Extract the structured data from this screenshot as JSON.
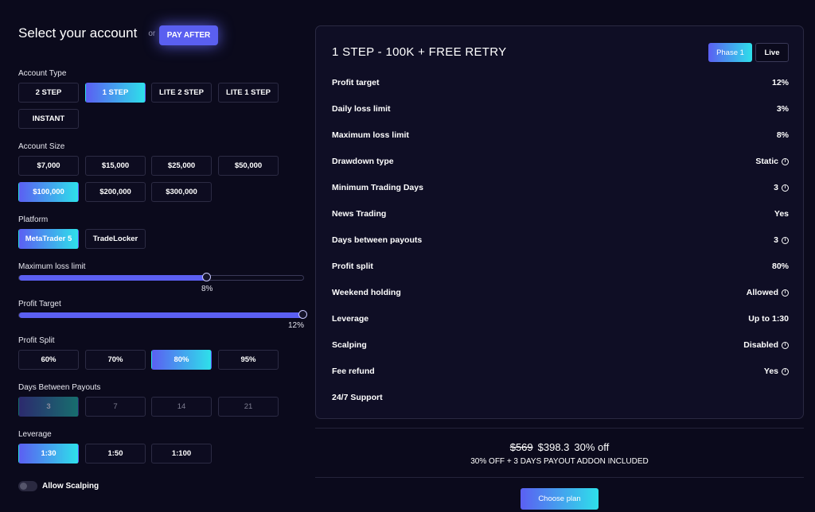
{
  "header": {
    "title": "Select your account",
    "or_text": "or",
    "pay_after_label": "PAY AFTER"
  },
  "account_type": {
    "label": "Account Type",
    "options": [
      "2 STEP",
      "1 STEP",
      "LITE 2 STEP",
      "LITE 1 STEP",
      "INSTANT"
    ],
    "selected": "1 STEP"
  },
  "account_size": {
    "label": "Account Size",
    "options": [
      "$7,000",
      "$15,000",
      "$25,000",
      "$50,000",
      "$100,000",
      "$200,000",
      "$300,000"
    ],
    "selected": "$100,000"
  },
  "platform": {
    "label": "Platform",
    "options": [
      "MetaTrader 5",
      "TradeLocker"
    ],
    "selected": "MetaTrader 5"
  },
  "max_loss_slider": {
    "label": "Maximum loss limit",
    "value_text": "8%",
    "fraction": 0.66
  },
  "profit_target_slider": {
    "label": "Profit Target",
    "value_text": "12%",
    "fraction": 1.0
  },
  "profit_split": {
    "label": "Profit Split",
    "options": [
      "60%",
      "70%",
      "80%",
      "95%"
    ],
    "selected": "80%"
  },
  "days_between_payouts": {
    "label": "Days Between Payouts",
    "options": [
      "3",
      "7",
      "14",
      "21"
    ],
    "selected": "3"
  },
  "leverage": {
    "label": "Leverage",
    "options": [
      "1:30",
      "1:50",
      "1:100"
    ],
    "selected": "1:30"
  },
  "scalping": {
    "label": "Allow Scalping",
    "enabled": false
  },
  "panel": {
    "title": "1 STEP - 100K + FREE RETRY",
    "phase_label": "Phase 1",
    "live_label": "Live",
    "rows": [
      {
        "label": "Profit target",
        "value": "12%",
        "info": false
      },
      {
        "label": "Daily loss limit",
        "value": "3%",
        "info": false
      },
      {
        "label": "Maximum loss limit",
        "value": "8%",
        "info": false
      },
      {
        "label": "Drawdown type",
        "value": "Static",
        "info": true
      },
      {
        "label": "Minimum Trading Days",
        "value": "3",
        "info": true
      },
      {
        "label": "News Trading",
        "value": "Yes",
        "info": false
      },
      {
        "label": "Days between payouts",
        "value": "3",
        "info": true
      },
      {
        "label": "Profit split",
        "value": "80%",
        "info": false
      },
      {
        "label": "Weekend holding",
        "value": "Allowed",
        "info": true
      },
      {
        "label": "Leverage",
        "value": "Up to 1:30",
        "info": false
      },
      {
        "label": "Scalping",
        "value": "Disabled",
        "info": true
      },
      {
        "label": "Fee refund",
        "value": "Yes",
        "info": true
      },
      {
        "label": "24/7 Support",
        "value": "",
        "info": false
      }
    ]
  },
  "pricing": {
    "old_price": "$569",
    "new_price": "$398.3",
    "discount": "30% off",
    "note": "30% OFF + 3 DAYS PAYOUT ADDON INCLUDED",
    "cta_label": "Choose plan"
  },
  "info_icon_glyph": "i",
  "colors": {
    "accent_start": "#5b5ff2",
    "accent_end": "#2ee0ea",
    "background": "#0b0a1c",
    "panel": "#0f0e25"
  }
}
